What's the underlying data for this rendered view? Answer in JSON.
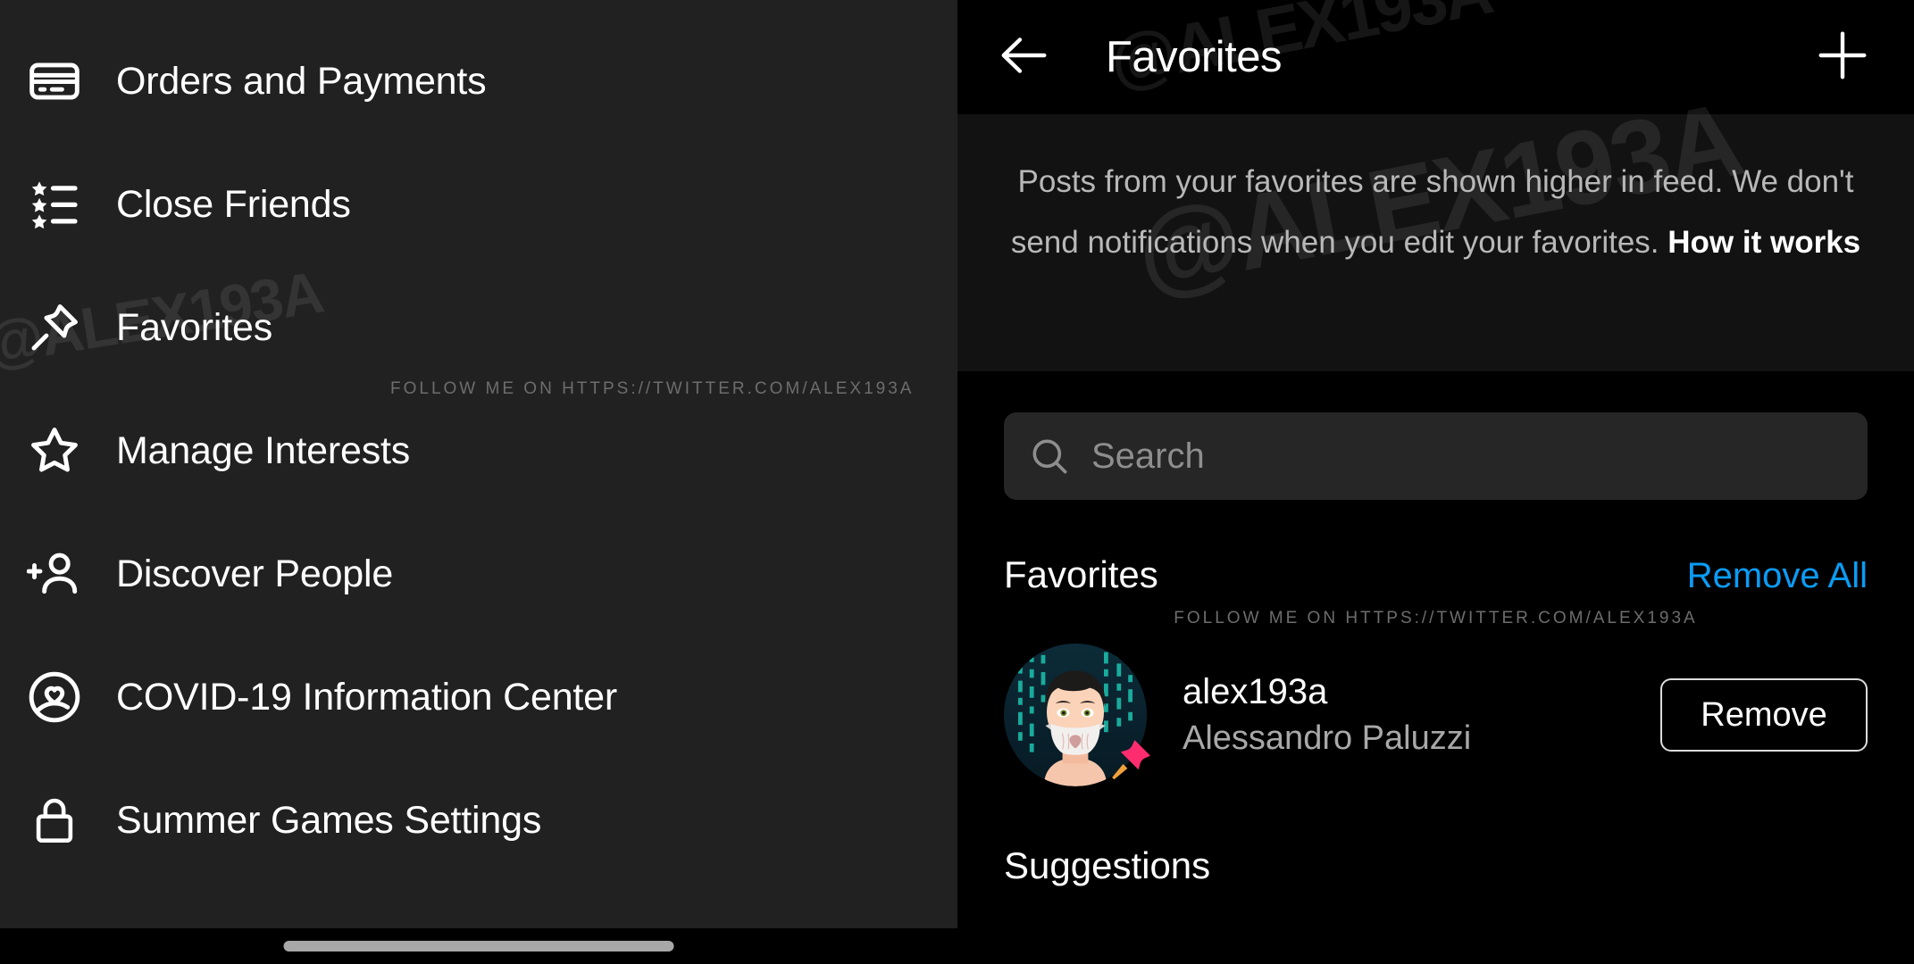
{
  "watermark": {
    "handle": "@ALEX193A",
    "follow_text": "FOLLOW ME ON HTTPS://TWITTER.COM/ALEX193A"
  },
  "colors": {
    "panel_left_bg": "#212121",
    "panel_right_bg": "#000000",
    "description_bg": "#121212",
    "accent_blue": "#0a9cf5",
    "search_bg": "#262626",
    "secondary_text": "#a8a8a8"
  },
  "sidebar": {
    "items": [
      {
        "label": "Orders and Payments",
        "icon": "credit-card-icon"
      },
      {
        "label": "Close Friends",
        "icon": "star-list-icon"
      },
      {
        "label": "Favorites",
        "icon": "pin-icon"
      },
      {
        "label": "Manage Interests",
        "icon": "star-outline-icon"
      },
      {
        "label": "Discover People",
        "icon": "person-add-icon"
      },
      {
        "label": "COVID-19 Information Center",
        "icon": "covid-heart-icon"
      },
      {
        "label": "Summer Games Settings",
        "icon": "lock-icon"
      }
    ]
  },
  "detail": {
    "header": {
      "back_icon": "arrow-left-icon",
      "title": "Favorites",
      "add_icon": "plus-icon"
    },
    "description": {
      "body": "Posts from your favorites are shown higher in feed. We don't send notifications when you edit your favorites. ",
      "link": "How it works"
    },
    "search": {
      "icon": "search-icon",
      "placeholder": "Search",
      "value": ""
    },
    "favorites_section": {
      "title": "Favorites",
      "remove_all_label": "Remove All",
      "entries": [
        {
          "username": "alex193a",
          "full_name": "Alessandro Paluzzi",
          "action_label": "Remove",
          "avatar": "user-avatar",
          "badge": "pin-badge-icon"
        }
      ]
    },
    "suggestions_section": {
      "title": "Suggestions"
    }
  },
  "system": {
    "home_indicator": "home-indicator"
  }
}
